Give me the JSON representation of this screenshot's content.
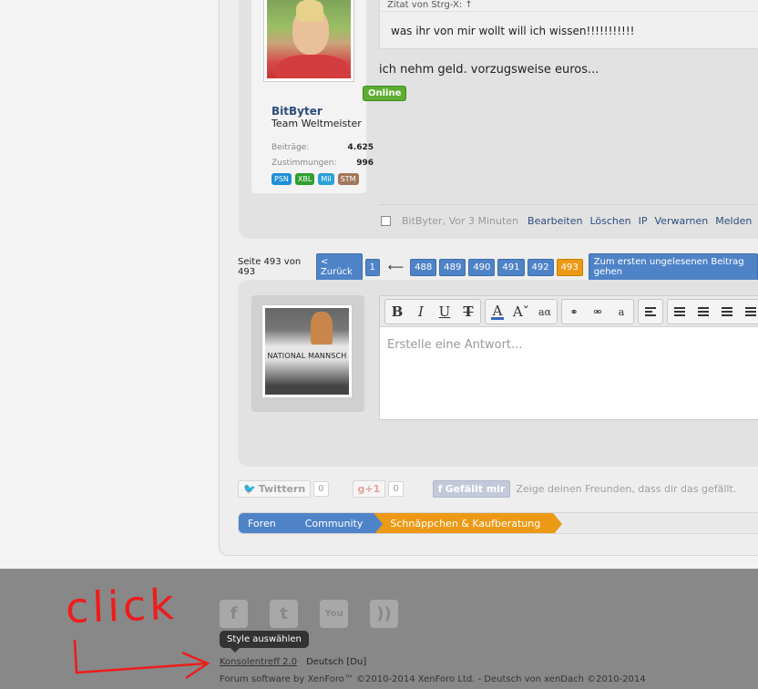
{
  "post": {
    "online_label": "Online",
    "username": "BitByter",
    "user_title": "Team Weltmeister",
    "stats": [
      {
        "label": "Beiträge:",
        "value": "4.625"
      },
      {
        "label": "Zustimmungen:",
        "value": "996"
      }
    ],
    "badges": [
      "PSN",
      "XBL",
      "Mii",
      "STM"
    ],
    "quote_author": "Zitat von Strg-X: ↑",
    "quote_text": "was ihr von mir wollt will ich wissen!!!!!!!!!!!",
    "message": "ich nehm geld. vorzugsweise euros...",
    "meta": "BitByter, Vor 3 Minuten",
    "actions": [
      "Bearbeiten",
      "Löschen",
      "IP",
      "Verwarnen",
      "Melden"
    ]
  },
  "pager": {
    "label": "Seite 493 von 493",
    "prev": "< Zurück",
    "first": "1",
    "arrow": "⟵",
    "pages": [
      "488",
      "489",
      "490",
      "491",
      "492"
    ],
    "current": "493",
    "unread": "Zum ersten ungelesenen Beitrag gehen"
  },
  "reply": {
    "placeholder": "Erstelle eine Antwort...",
    "avatar_caption": "NATIONAL MANNSCH"
  },
  "social": {
    "tweet": "Twittern",
    "tweet_count": "0",
    "gplus": "g+1",
    "gplus_count": "0",
    "fb": "Gefällt mir",
    "fb_text": "Zeige deinen Freunden, dass dir das gefällt."
  },
  "breadcrumb": [
    "Foren",
    "Community",
    "Schnäppchen & Kaufberatung"
  ],
  "footer": {
    "tooltip": "Style auswählen",
    "style_link": "Konsolentreff 2.0",
    "language": "Deutsch [Du]",
    "copyright": "Forum software by XenForo™ ©2010-2014 XenForo Ltd. - Deutsch von xenDach ©2010-2014"
  },
  "annotation": {
    "text": "click"
  },
  "colors": {
    "link_blue": "#4f83c7",
    "active_orange": "#ec9a16",
    "online_green": "#5dad32",
    "annotation_red": "#ee1c1c"
  }
}
